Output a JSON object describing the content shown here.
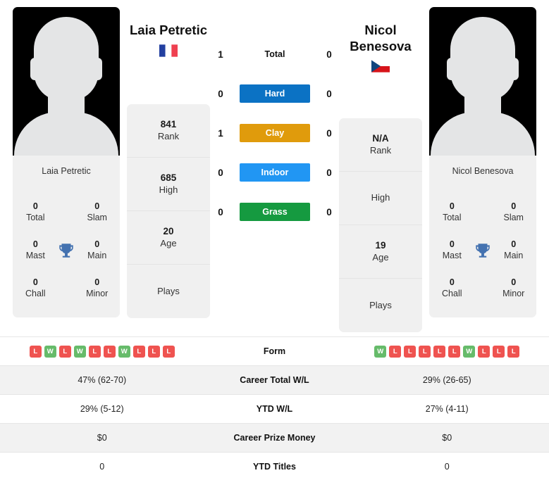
{
  "players": {
    "left": {
      "name": "Laia Petretic",
      "card_name": "Laia Petretic",
      "flag": "fr-flag-icon",
      "flag_country": "France",
      "rank": "841",
      "rank_label": "Rank",
      "high": "685",
      "high_label": "High",
      "age": "20",
      "age_label": "Age",
      "plays": "",
      "plays_label": "Plays",
      "titles": {
        "total": "0",
        "total_label": "Total",
        "slam": "0",
        "slam_label": "Slam",
        "mast": "0",
        "mast_label": "Mast",
        "main": "0",
        "main_label": "Main",
        "chall": "0",
        "chall_label": "Chall",
        "minor": "0",
        "minor_label": "Minor"
      },
      "form": [
        "L",
        "W",
        "L",
        "W",
        "L",
        "L",
        "W",
        "L",
        "L",
        "L"
      ]
    },
    "right": {
      "name": "Nicol Benesova",
      "card_name": "Nicol Benesova",
      "flag": "cz-flag-icon",
      "flag_country": "Czech Republic",
      "rank": "N/A",
      "rank_label": "Rank",
      "high": "",
      "high_label": "High",
      "age": "19",
      "age_label": "Age",
      "plays": "",
      "plays_label": "Plays",
      "titles": {
        "total": "0",
        "total_label": "Total",
        "slam": "0",
        "slam_label": "Slam",
        "mast": "0",
        "mast_label": "Mast",
        "main": "0",
        "main_label": "Main",
        "chall": "0",
        "chall_label": "Chall",
        "minor": "0",
        "minor_label": "Minor"
      },
      "form": [
        "W",
        "L",
        "L",
        "L",
        "L",
        "L",
        "W",
        "L",
        "L",
        "L"
      ]
    }
  },
  "h2h": {
    "rows": [
      {
        "label": "Total",
        "left": "1",
        "right": "0",
        "color": "none",
        "style": "plain"
      },
      {
        "label": "Hard",
        "left": "0",
        "right": "0",
        "color": "#0b72c4",
        "style": "badge"
      },
      {
        "label": "Clay",
        "left": "1",
        "right": "0",
        "color": "#e09b0c",
        "style": "badge"
      },
      {
        "label": "Indoor",
        "left": "0",
        "right": "0",
        "color": "#2196f3",
        "style": "badge"
      },
      {
        "label": "Grass",
        "left": "0",
        "right": "0",
        "color": "#159a40",
        "style": "badge"
      }
    ]
  },
  "stats_table": {
    "rows": [
      {
        "label": "Form",
        "left": "",
        "right": "",
        "type": "form",
        "stripe": false
      },
      {
        "label": "Career Total W/L",
        "left": "47% (62-70)",
        "right": "29% (26-65)",
        "type": "text",
        "stripe": true
      },
      {
        "label": "YTD W/L",
        "left": "29% (5-12)",
        "right": "27% (4-11)",
        "type": "text",
        "stripe": false
      },
      {
        "label": "Career Prize Money",
        "left": "$0",
        "right": "$0",
        "type": "text",
        "stripe": true
      },
      {
        "label": "YTD Titles",
        "left": "0",
        "right": "0",
        "type": "text",
        "stripe": false
      }
    ]
  },
  "colors": {
    "hard": "#0b72c4",
    "clay": "#e09b0c",
    "indoor": "#2196f3",
    "grass": "#159a40",
    "win": "#66bb6a",
    "loss": "#ef5350",
    "trophy": "#4472b0",
    "card_bg": "#f0f0f0"
  }
}
